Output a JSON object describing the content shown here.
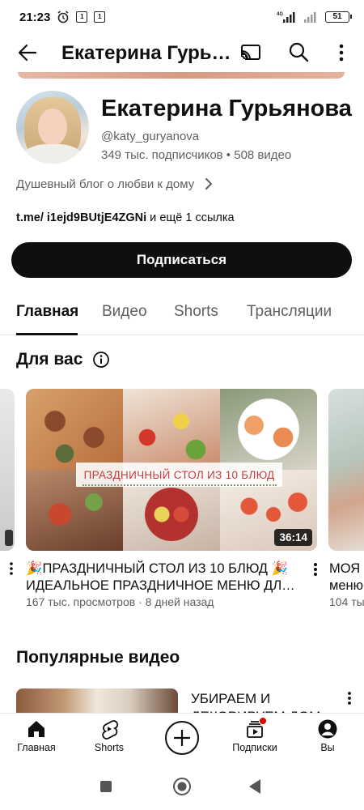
{
  "status_bar": {
    "time": "21:23",
    "badge1": "1",
    "badge2": "1",
    "network": "4G",
    "battery": "51"
  },
  "header": {
    "title": "Екатерина Гурь…",
    "icons": [
      "back-arrow-icon",
      "cast-icon",
      "search-icon",
      "more-vert-icon"
    ]
  },
  "channel": {
    "name": "Екатерина Гурьянова",
    "handle": "@katy_guryanova",
    "subscribers": "349 тыс. подписчиков",
    "separator": " • ",
    "videos": "508 видео",
    "description": "Душевный блог о любви к дому",
    "link_main": "t.me/ i1ejd9BUtjE4ZGNi",
    "link_more": " и ещё 1 ссылка",
    "subscribe_label": "Подписаться"
  },
  "tabs": [
    {
      "label": "Главная",
      "active": true
    },
    {
      "label": "Видео",
      "active": false
    },
    {
      "label": "Shorts",
      "active": false
    },
    {
      "label": "Трансляции",
      "active": false
    }
  ],
  "for_you": {
    "title": "Для вас",
    "video": {
      "title_line1": "🎉ПРАЗДНИЧНЫЙ СТОЛ ИЗ 10 БЛЮД 🎉",
      "title_line2": "ИДЕАЛЬНОЕ ПРАЗДНИЧНОЕ МЕНЮ ДЛ…",
      "thumbnail_text": "ПРАЗДНИЧНЫЙ СТОЛ ИЗ 10 БЛЮД",
      "duration": "36:14",
      "views": "167 тыс. просмотров",
      "age": "8 дней назад"
    },
    "next_video": {
      "title_line1": "МОЯ",
      "title_line2": "меню",
      "meta": "104 ты"
    }
  },
  "popular": {
    "title": "Популярные видео",
    "video": {
      "title_line1": "УБИРАЕМ И",
      "title_line2": "ДЕКОРИРУЕМ ДОМ"
    }
  },
  "bottom_nav": [
    {
      "label": "Главная",
      "icon": "home-icon"
    },
    {
      "label": "Shorts",
      "icon": "shorts-icon"
    },
    {
      "label": "",
      "icon": "create-plus-icon"
    },
    {
      "label": "Подписки",
      "icon": "subscriptions-icon"
    },
    {
      "label": "Вы",
      "icon": "account-icon"
    }
  ],
  "colors": {
    "accent_dark": "#0f0f0f",
    "secondary_text": "#606060",
    "notification_dot": "#e00000"
  }
}
